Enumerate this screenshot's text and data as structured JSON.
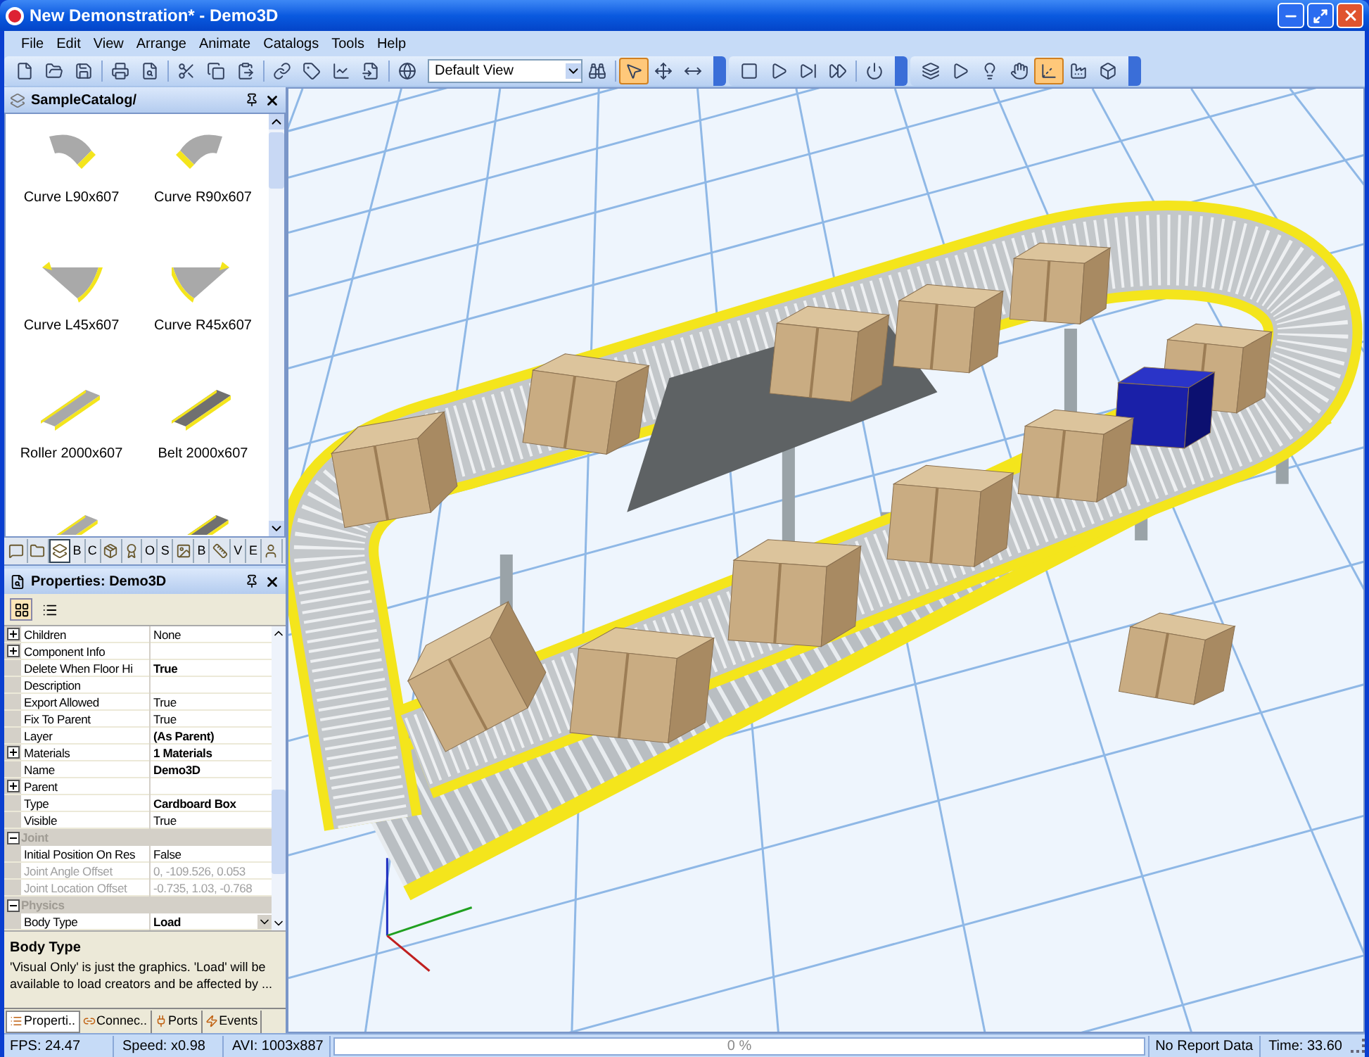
{
  "window": {
    "title": "New Demonstration* - Demo3D"
  },
  "menu": [
    "File",
    "Edit",
    "View",
    "Arrange",
    "Animate",
    "Catalogs",
    "Tools",
    "Help"
  ],
  "toolbar": {
    "view_select": "Default View",
    "buttons": [
      {
        "selected": false
      },
      {
        "selected": false
      },
      {
        "selected": false
      },
      {
        "selected": false
      },
      {
        "selected": false
      },
      {
        "selected": false
      },
      {
        "selected": false
      },
      {
        "selected": false
      },
      {
        "selected": false
      },
      {
        "selected": false
      },
      {
        "selected": false
      },
      {
        "selected": false
      },
      {
        "selected": false
      },
      {
        "selected": false
      },
      {
        "selected": true
      },
      {
        "selected": false
      },
      {
        "selected": false
      },
      {
        "selected": false
      },
      {
        "selected": false
      },
      {
        "selected": false
      },
      {
        "selected": false
      },
      {
        "selected": false
      },
      {
        "selected": false
      },
      {
        "selected": false
      },
      {
        "selected": false
      },
      {
        "selected": false
      },
      {
        "selected": true
      },
      {
        "selected": false
      },
      {
        "selected": false
      }
    ]
  },
  "catalog": {
    "title": "SampleCatalog/",
    "items": [
      {
        "kind": "curve-left",
        "label": "Curve L90x607"
      },
      {
        "kind": "curve-right",
        "label": "Curve R90x607"
      },
      {
        "kind": "wedge-left",
        "label": "Curve L45x607"
      },
      {
        "kind": "wedge-right",
        "label": "Curve R45x607"
      },
      {
        "kind": "roller",
        "label": "Roller 2000x607"
      },
      {
        "kind": "belt",
        "label": "Belt 2000x607"
      },
      {
        "kind": "roller"
      },
      {
        "kind": "belt"
      }
    ],
    "tabs": [
      {
        "kind": "icon",
        "selected": false
      },
      {
        "kind": "icon",
        "selected": false
      },
      {
        "kind": "icon",
        "selected": true
      },
      {
        "kind": "letter",
        "label": "B",
        "selected": false
      },
      {
        "kind": "letter",
        "label": "C",
        "selected": false
      },
      {
        "kind": "icon",
        "selected": false
      },
      {
        "kind": "icon",
        "selected": false
      },
      {
        "kind": "letter",
        "label": "O",
        "selected": false
      },
      {
        "kind": "letter",
        "label": "S",
        "selected": false
      },
      {
        "kind": "icon",
        "selected": false
      },
      {
        "kind": "letter",
        "label": "B",
        "selected": false
      },
      {
        "kind": "icon",
        "selected": false
      },
      {
        "kind": "letter",
        "label": "V",
        "selected": false
      },
      {
        "kind": "letter",
        "label": "E",
        "selected": false
      },
      {
        "kind": "icon",
        "selected": false
      }
    ]
  },
  "properties": {
    "title": "Properties: Demo3D",
    "rows": [
      {
        "kind": "property",
        "name": "Children",
        "value": "None",
        "expanded": false,
        "bold": false,
        "disabled": false
      },
      {
        "kind": "property",
        "name": "Component Info",
        "expanded": false,
        "disabled": false
      },
      {
        "kind": "property",
        "name": "Delete When Floor Hi",
        "value": "True",
        "bold": true,
        "disabled": false
      },
      {
        "kind": "property",
        "name": "Description",
        "disabled": false
      },
      {
        "kind": "property",
        "name": "Export Allowed",
        "value": "True",
        "bold": false,
        "disabled": false
      },
      {
        "kind": "property",
        "name": "Fix To Parent",
        "value": "True",
        "bold": false,
        "disabled": false
      },
      {
        "kind": "property",
        "name": "Layer",
        "value": "(As Parent)",
        "bold": true,
        "disabled": false
      },
      {
        "kind": "property",
        "name": "Materials",
        "value": "1 Materials",
        "expanded": false,
        "bold": true,
        "disabled": false
      },
      {
        "kind": "property",
        "name": "Name",
        "value": "Demo3D",
        "bold": true,
        "disabled": false
      },
      {
        "kind": "property",
        "name": "Parent",
        "expanded": false,
        "disabled": false
      },
      {
        "kind": "property",
        "name": "Type",
        "value": "Cardboard Box",
        "bold": true,
        "disabled": false
      },
      {
        "kind": "property",
        "name": "Visible",
        "value": "True",
        "bold": false,
        "disabled": false
      },
      {
        "kind": "category",
        "name": "Joint",
        "expanded": true
      },
      {
        "kind": "property",
        "name": "Initial Position On Res",
        "value": "False",
        "bold": false,
        "disabled": false
      },
      {
        "kind": "property",
        "name": "Joint Angle Offset",
        "value": "0, -109.526, 0.053",
        "bold": false,
        "disabled": true
      },
      {
        "kind": "property",
        "name": "Joint Location Offset",
        "value": "-0.735, 1.03, -0.768",
        "bold": false,
        "disabled": true
      },
      {
        "kind": "category",
        "name": "Physics",
        "expanded": true
      },
      {
        "kind": "dropdown",
        "name": "Body Type",
        "value": "Load",
        "bold": true,
        "disabled": false
      }
    ],
    "help_title": "Body Type",
    "help_text": "'Visual Only' is just the graphics. 'Load' will be available to load creators and be affected by ..."
  },
  "bottom_tabs": [
    {
      "label": "Properti..",
      "selected": true
    },
    {
      "label": "Connec..",
      "selected": false
    },
    {
      "label": "Ports",
      "selected": false
    },
    {
      "label": "Events",
      "selected": false
    }
  ],
  "status_bar": {
    "fps": "FPS: 24.47",
    "speed": "Speed: x0.98",
    "avi": "AVI: 1003x887",
    "progress": {
      "label": "0 %",
      "level": 0
    },
    "report": "No Report Data",
    "time": "Time: 33.60"
  }
}
